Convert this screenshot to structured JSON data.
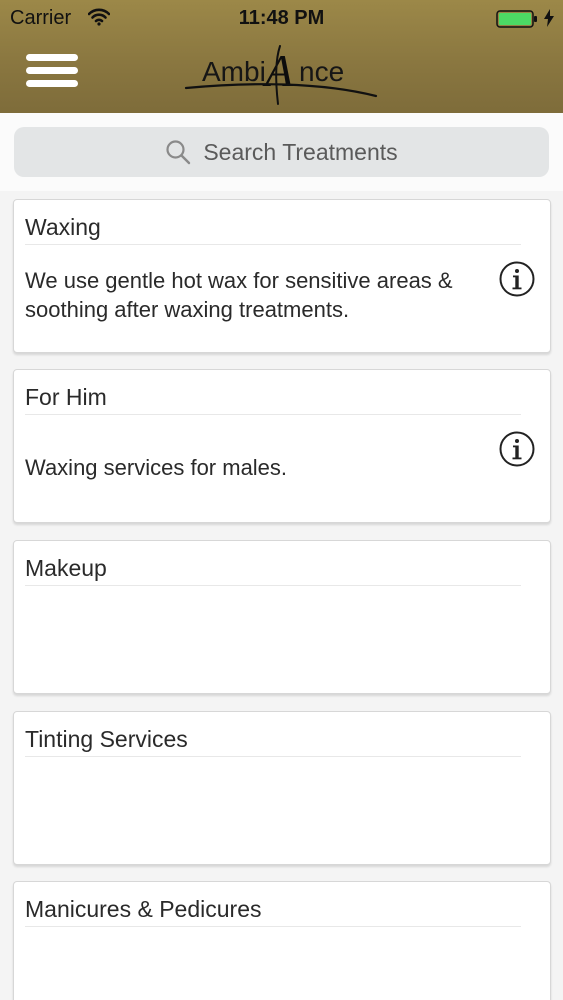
{
  "status_bar": {
    "carrier": "Carrier",
    "time": "11:48 PM",
    "battery_color": "#4cd964"
  },
  "header": {
    "menu_icon": "hamburger-menu-icon",
    "logo_text_left": "Ambi",
    "logo_letter": "A",
    "logo_text_right": "nce",
    "background_color": "#8a7740"
  },
  "search": {
    "placeholder": "Search Treatments"
  },
  "categories": [
    {
      "title": "Waxing",
      "description": "We use gentle hot wax for sensitive areas & soothing after waxing treatments.",
      "has_info": true
    },
    {
      "title": "For Him",
      "description": "Waxing services for males.",
      "has_info": true
    },
    {
      "title": "Makeup",
      "description": "",
      "has_info": false
    },
    {
      "title": "Tinting Services",
      "description": "",
      "has_info": false
    },
    {
      "title": "Manicures & Pedicures",
      "description": "",
      "has_info": false
    }
  ]
}
